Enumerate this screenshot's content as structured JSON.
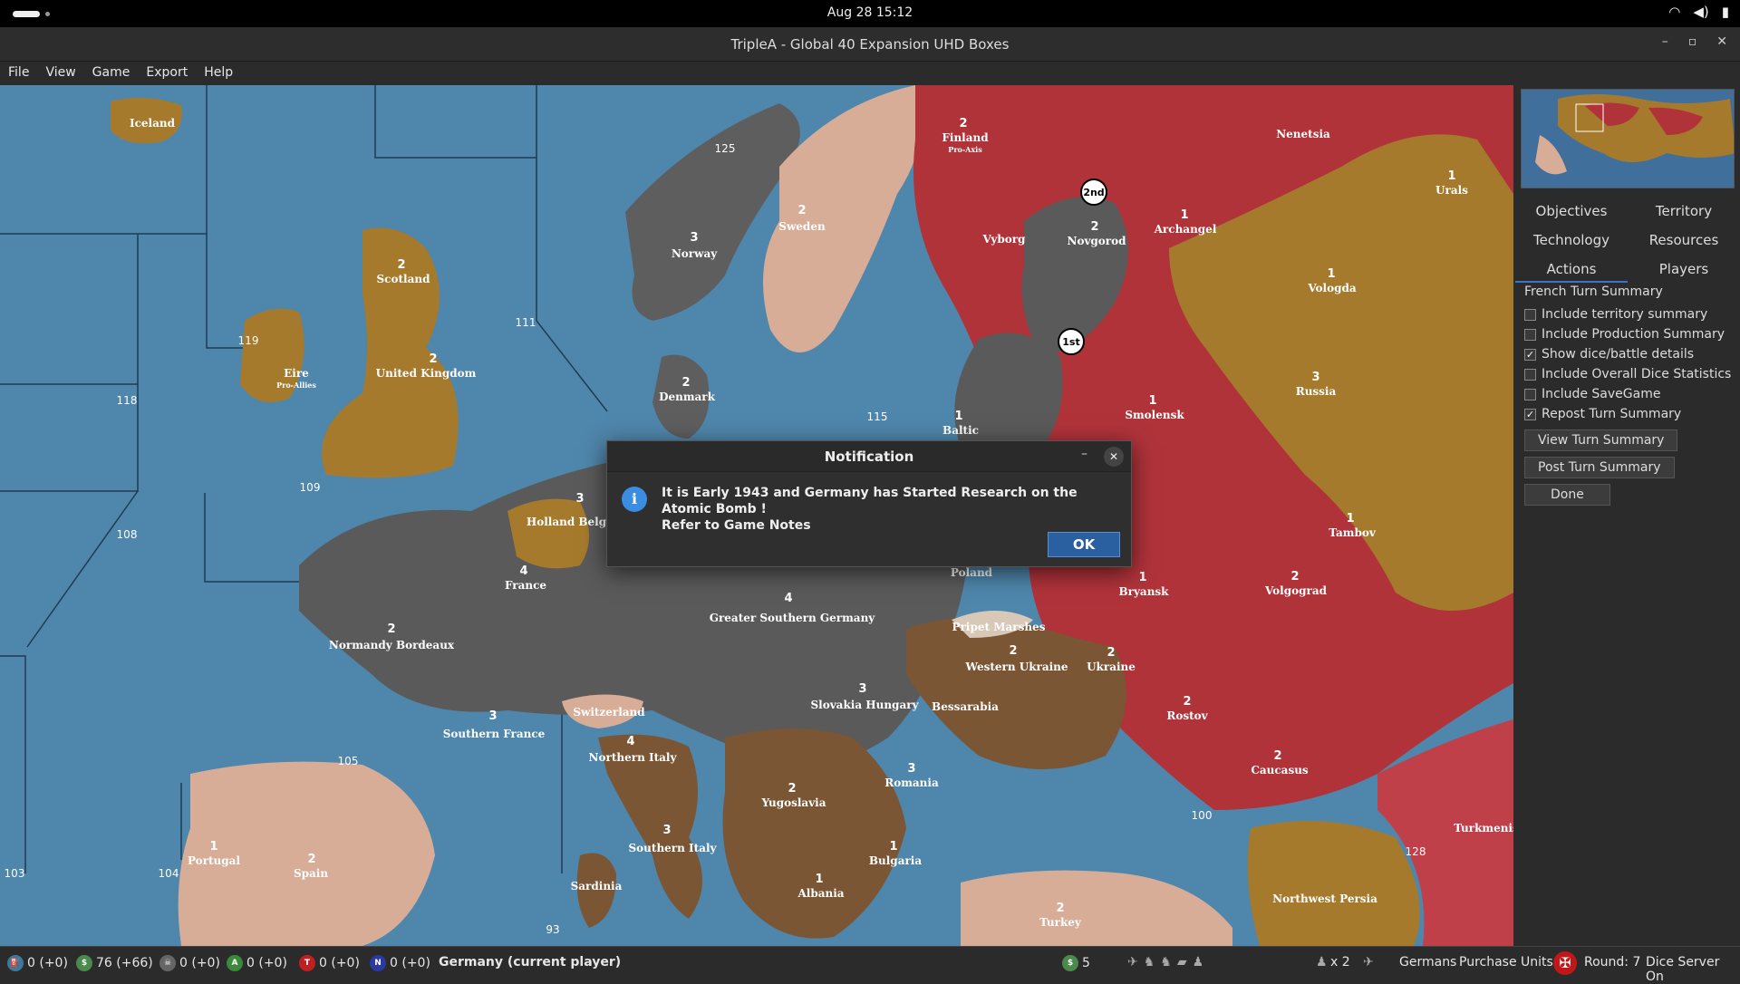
{
  "system": {
    "clock": "Aug 28  15:12",
    "tray_icons": [
      "wifi-icon",
      "volume-icon",
      "battery-icon"
    ]
  },
  "window": {
    "title": "TripleA - Global 40 Expansion UHD Boxes",
    "controls": [
      "–",
      "▫",
      "✕"
    ]
  },
  "menu": [
    "File",
    "View",
    "Game",
    "Export",
    "Help"
  ],
  "map": {
    "territories": [
      {
        "name": "Iceland",
        "num": ""
      },
      {
        "name": "Scotland",
        "num": "2"
      },
      {
        "name": "Eire",
        "num": ""
      },
      {
        "name": "Pro-Allies",
        "num": ""
      },
      {
        "name": "United Kingdom",
        "num": "2"
      },
      {
        "name": "Norway",
        "num": "3"
      },
      {
        "name": "Sweden",
        "num": "2"
      },
      {
        "name": "Finland",
        "num": "2"
      },
      {
        "name": "Pro-Axis",
        "num": ""
      },
      {
        "name": "Vyborg",
        "num": ""
      },
      {
        "name": "Novgorod",
        "num": "2"
      },
      {
        "name": "Archangel",
        "num": "1"
      },
      {
        "name": "Nenetsia",
        "num": ""
      },
      {
        "name": "Urals",
        "num": "1"
      },
      {
        "name": "Vologda",
        "num": "1"
      },
      {
        "name": "Denmark",
        "num": "2"
      },
      {
        "name": "Baltic",
        "num": "1"
      },
      {
        "name": "Smolensk",
        "num": "1"
      },
      {
        "name": "Russia",
        "num": "3"
      },
      {
        "name": "Tambov",
        "num": "1"
      },
      {
        "name": "Holland Belgium",
        "num": "3"
      },
      {
        "name": "France",
        "num": "4"
      },
      {
        "name": "Normandy Bordeaux",
        "num": "2"
      },
      {
        "name": "Poland",
        "num": ""
      },
      {
        "name": "Greater Southern Germany",
        "num": "4"
      },
      {
        "name": "Bryansk",
        "num": "1"
      },
      {
        "name": "Volgograd",
        "num": "2"
      },
      {
        "name": "Pripet Marshes",
        "num": ""
      },
      {
        "name": "Western Ukraine",
        "num": "2"
      },
      {
        "name": "Ukraine",
        "num": "2"
      },
      {
        "name": "Switzerland",
        "num": ""
      },
      {
        "name": "Slovakia Hungary",
        "num": "3"
      },
      {
        "name": "Bessarabia",
        "num": ""
      },
      {
        "name": "Southern France",
        "num": "3"
      },
      {
        "name": "Northern Italy",
        "num": "4"
      },
      {
        "name": "Rostov",
        "num": "2"
      },
      {
        "name": "Caucasus",
        "num": "2"
      },
      {
        "name": "Yugoslavia",
        "num": "2"
      },
      {
        "name": "Romania",
        "num": "3"
      },
      {
        "name": "Portugal",
        "num": "1"
      },
      {
        "name": "Spain",
        "num": "2"
      },
      {
        "name": "Southern Italy",
        "num": "3"
      },
      {
        "name": "Bulgaria",
        "num": "1"
      },
      {
        "name": "Albania",
        "num": "1"
      },
      {
        "name": "Sardinia",
        "num": ""
      },
      {
        "name": "Turkey",
        "num": "2"
      },
      {
        "name": "Northwest Persia",
        "num": ""
      },
      {
        "name": "Turkmenis",
        "num": ""
      }
    ],
    "sea_zones": [
      "125",
      "119",
      "118",
      "111",
      "109",
      "108",
      "115",
      "105",
      "104",
      "103",
      "93",
      "100",
      "128"
    ],
    "markers": [
      "2nd",
      "1st"
    ]
  },
  "sidebar": {
    "tabs_row1": [
      "Objectives",
      "Territory"
    ],
    "tabs_row2": [
      "Technology",
      "Resources"
    ],
    "tabs_row3": [
      "Actions",
      "Players"
    ],
    "active_tab": "Actions",
    "summary_title": "French Turn Summary",
    "options": [
      {
        "label": "Include territory summary",
        "checked": false
      },
      {
        "label": "Include Production Summary",
        "checked": false
      },
      {
        "label": "Show dice/battle details",
        "checked": true
      },
      {
        "label": "Include Overall Dice Statistics",
        "checked": false
      },
      {
        "label": "Include SaveGame",
        "checked": false
      },
      {
        "label": "Repost Turn Summary",
        "checked": true
      }
    ],
    "view_button": "View Turn Summary",
    "post_button": "Post Turn Summary",
    "done_button": "Done"
  },
  "status": {
    "res1": "0 (+0)",
    "res2": "76 (+66)",
    "res3": "0 (+0)",
    "res4": "0 (+0)",
    "res5": "0 (+0)",
    "res6": "0 (+0)",
    "current_player": "Germany (current player)",
    "units_count": "5",
    "units_multiplier": "x 2",
    "nation": "Germans",
    "phase": "Purchase Units",
    "round": "Round: 7",
    "dice": "Dice Server On"
  },
  "dialog": {
    "title": "Notification",
    "message_line1": "It is Early 1943 and Germany has Started Research on the Atomic Bomb !",
    "message_line2": "Refer to Game Notes",
    "ok": "OK"
  },
  "colors": {
    "sea": "#4f86ab",
    "germany": "#5a5a5a",
    "ussr": "#b0333a",
    "uk": "#a67a2c",
    "neutral": "#d8ad98",
    "italy": "#7a5634",
    "accent": "#3a76c4"
  }
}
